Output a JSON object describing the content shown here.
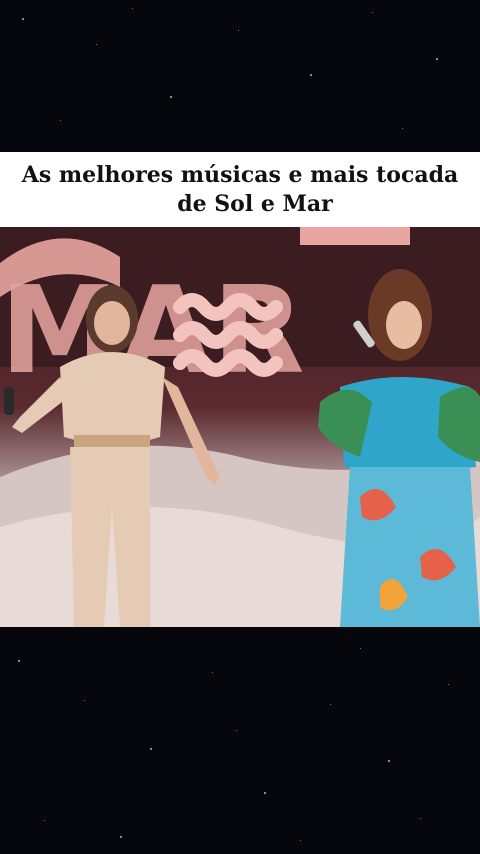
{
  "caption": {
    "line1": "As melhores músicas e mais tocada",
    "line2": "de Sol e Mar"
  },
  "video": {
    "backdrop_text": "MAR"
  },
  "colors": {
    "background": "#05070d",
    "caption_bg": "#ffffff",
    "caption_text": "#111111",
    "stage_pink": "#e9a6a0"
  }
}
